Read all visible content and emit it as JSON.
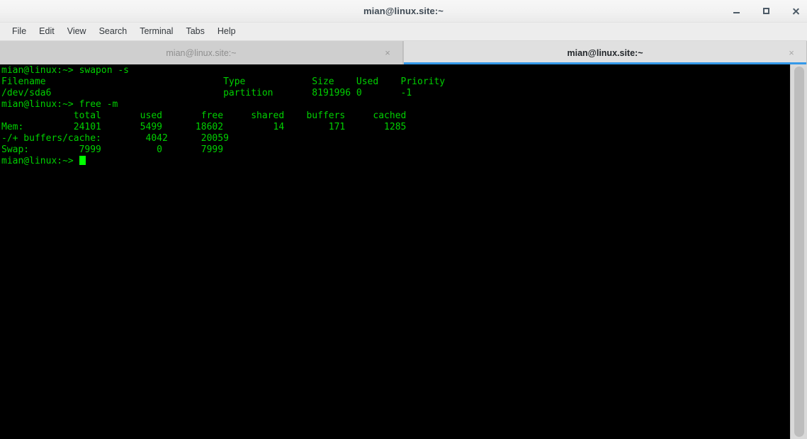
{
  "window": {
    "title": "mian@linux.site:~",
    "controls": [
      {
        "name": "minimize-button",
        "label": "–"
      },
      {
        "name": "maximize-button",
        "label": "□"
      },
      {
        "name": "close-button",
        "label": "✕"
      }
    ]
  },
  "menubar": {
    "items": [
      {
        "label": "File"
      },
      {
        "label": "Edit"
      },
      {
        "label": "View"
      },
      {
        "label": "Search"
      },
      {
        "label": "Terminal"
      },
      {
        "label": "Tabs"
      },
      {
        "label": "Help"
      }
    ]
  },
  "tabs": [
    {
      "label": "mian@linux.site:~",
      "active": false,
      "close": "×"
    },
    {
      "label": "mian@linux.site:~",
      "active": true,
      "close": "×"
    }
  ],
  "terminal": {
    "colors": {
      "background": "#000000",
      "foreground": "#00d000",
      "cursor": "#00ff00"
    },
    "lines": [
      "mian@linux:~> swapon -s",
      "Filename                                Type            Size    Used    Priority",
      "/dev/sda6                               partition       8191996 0       -1",
      "mian@linux:~> free -m",
      "             total       used       free     shared    buffers     cached",
      "Mem:         24101       5499      18602         14        171       1285",
      "-/+ buffers/cache:        4042      20059",
      "Swap:         7999          0       7999"
    ],
    "prompt": "mian@linux:~> ",
    "commands": [
      "swapon -s",
      "free -m"
    ],
    "swapon_table": {
      "headers": [
        "Filename",
        "Type",
        "Size",
        "Used",
        "Priority"
      ],
      "rows": [
        [
          "/dev/sda6",
          "partition",
          "8191996",
          "0",
          "-1"
        ]
      ]
    },
    "free_table": {
      "headers": [
        "",
        "total",
        "used",
        "free",
        "shared",
        "buffers",
        "cached"
      ],
      "rows": [
        [
          "Mem:",
          "24101",
          "5499",
          "18602",
          "14",
          "171",
          "1285"
        ],
        [
          "-/+ buffers/cache:",
          "",
          "4042",
          "20059",
          "",
          "",
          ""
        ],
        [
          "Swap:",
          "7999",
          "0",
          "7999",
          "",
          "",
          ""
        ]
      ]
    }
  }
}
